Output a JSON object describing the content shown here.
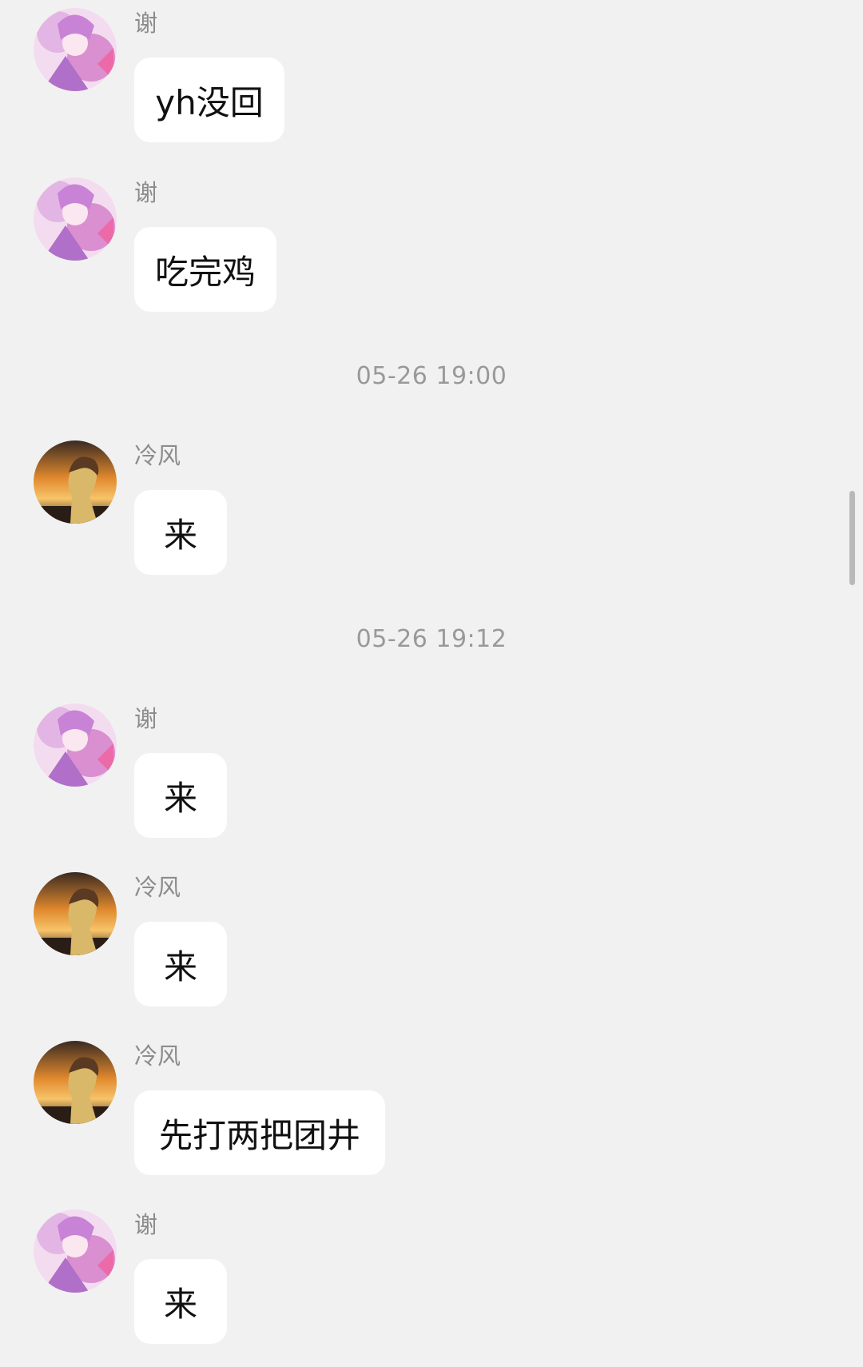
{
  "users": {
    "xie": {
      "name": "谢",
      "avatar_icon": "anime-girl-pink-avatar",
      "avatar_colors": [
        "#f3dcef",
        "#d98fd0",
        "#b06fc8",
        "#ffffff"
      ]
    },
    "lengfeng": {
      "name": "冷风",
      "avatar_icon": "anime-boy-sunset-avatar",
      "avatar_colors": [
        "#f7c46a",
        "#e0892d",
        "#5a3a22",
        "#2a1d16"
      ]
    }
  },
  "messages": [
    {
      "sender": "谢",
      "text": "yh没回"
    },
    {
      "sender": "谢",
      "text": "吃完鸡"
    },
    {
      "sender": "冷风",
      "text": "来"
    },
    {
      "sender": "谢",
      "text": "来"
    },
    {
      "sender": "冷风",
      "text": "来"
    },
    {
      "sender": "冷风",
      "text": "先打两把团井"
    },
    {
      "sender": "谢",
      "text": "来"
    }
  ],
  "timestamps": [
    "05-26 19:00",
    "05-26 19:12"
  ],
  "colors": {
    "background": "#f1f1f1",
    "bubble": "#ffffff",
    "sender_text": "#8c8c8c",
    "timestamp_text": "#999999"
  }
}
